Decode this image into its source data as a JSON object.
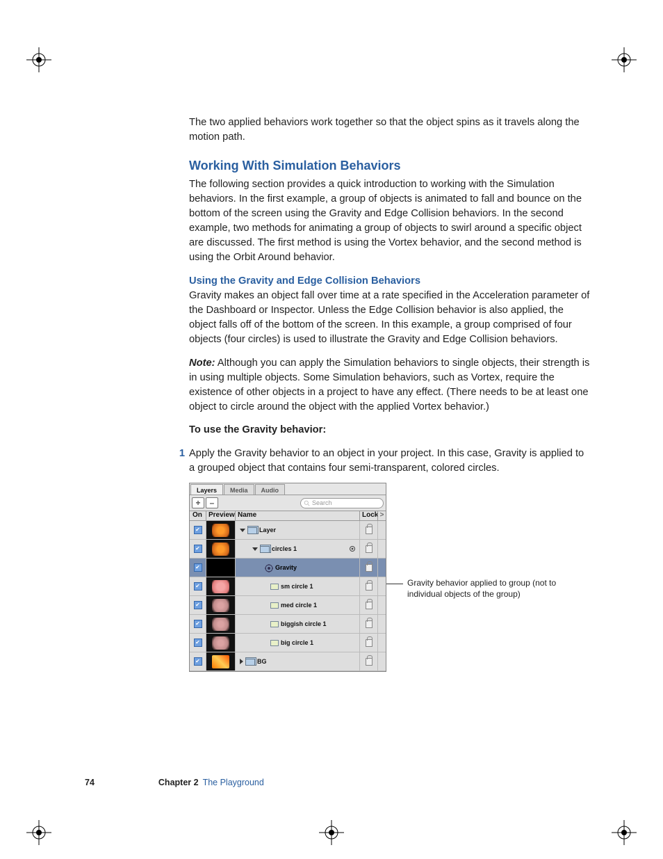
{
  "intro_para": "The two applied behaviors work together so that the object spins as it travels along the motion path.",
  "section_heading": "Working With Simulation Behaviors",
  "section_para": "The following section provides a quick introduction to working with the Simulation behaviors. In the first example, a group of objects is animated to fall and bounce on the bottom of the screen using the Gravity and Edge Collision behaviors. In the second example, two methods for animating a group of objects to swirl around a specific object are discussed. The first method is using the Vortex behavior, and the second method is using the Orbit Around behavior.",
  "sub_heading": "Using the Gravity and Edge Collision Behaviors",
  "sub_para": "Gravity makes an object fall over time at a rate specified in the Acceleration parameter of the Dashboard or Inspector. Unless the Edge Collision behavior is also applied, the object falls off of the bottom of the screen. In this example, a group comprised of four objects (four circles) is used to illustrate the Gravity and Edge Collision behaviors.",
  "note_label": "Note:",
  "note_body": "  Although you can apply the Simulation behaviors to single objects, their strength is in using multiple objects. Some Simulation behaviors, such as Vortex, require the existence of other objects in a project to have any effect. (There needs to be at least one object to circle around the object with the applied Vortex behavior.)",
  "task_head": "To use the Gravity behavior:",
  "step1_num": "1",
  "step1_body": "Apply the Gravity behavior to an object in your project. In this case, Gravity is applied to a grouped object that contains four semi-transparent, colored circles.",
  "callout": "Gravity behavior applied to group (not to individual objects of the group)",
  "footer": {
    "page": "74",
    "chapter": "Chapter 2",
    "title": "The Playground"
  },
  "panel": {
    "tabs": [
      "Layers",
      "Media",
      "Audio"
    ],
    "plus": "+",
    "minus": "–",
    "search_placeholder": "Search",
    "headers": {
      "on": "On",
      "preview": "Preview",
      "name": "Name",
      "lock": "Lock",
      "x": ">"
    },
    "rows": [
      {
        "name": "Layer",
        "thumb": "orange",
        "indent": 1,
        "disclosure": "down",
        "icon": "group"
      },
      {
        "name": "circles 1",
        "thumb": "orange",
        "indent": 2,
        "disclosure": "down",
        "icon": "group",
        "gear": true
      },
      {
        "name": "Gravity",
        "thumb": "none",
        "indent": 3,
        "icon": "behavior",
        "selected": true
      },
      {
        "name": "sm circle 1",
        "thumb": "pink",
        "indent": 4,
        "icon": "layer"
      },
      {
        "name": "med circle 1",
        "thumb": "pinkblur",
        "indent": 4,
        "icon": "layer"
      },
      {
        "name": "biggish circle 1",
        "thumb": "pinkblur",
        "indent": 4,
        "icon": "layer"
      },
      {
        "name": "big circle 1",
        "thumb": "pinkblur",
        "indent": 4,
        "icon": "layer"
      },
      {
        "name": "BG",
        "thumb": "fire",
        "indent": 1,
        "disclosure": "right",
        "icon": "group"
      }
    ]
  }
}
